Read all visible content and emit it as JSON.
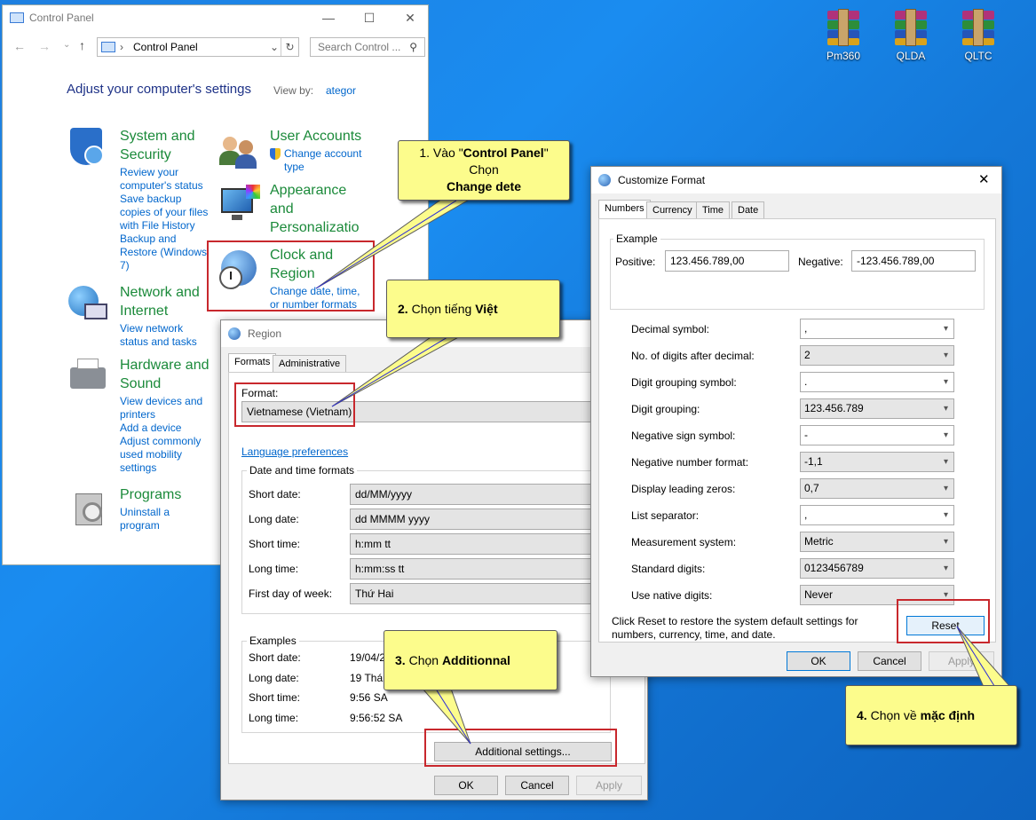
{
  "desktop": {
    "icons": [
      {
        "label": "Pm360"
      },
      {
        "label": "QLDA"
      },
      {
        "label": "QLTC"
      }
    ]
  },
  "control_panel": {
    "title": "Control Panel",
    "address": "Control Panel",
    "search_placeholder": "Search Control ...",
    "heading": "Adjust your computer's settings",
    "view_by_label": "View by:",
    "view_by_value": "ategor",
    "categories": [
      {
        "title": "System and Security",
        "links": [
          "Review your computer's status",
          "Save backup copies of your files with File History",
          "Backup and Restore (Windows 7)"
        ]
      },
      {
        "title": "Network and Internet",
        "links": [
          "View network status and tasks"
        ]
      },
      {
        "title": "Hardware and Sound",
        "links": [
          "View devices and printers",
          "Add a device",
          "Adjust commonly used mobility settings"
        ]
      },
      {
        "title": "Programs",
        "links": [
          "Uninstall a program"
        ]
      },
      {
        "title": "User Accounts",
        "links": [
          "Change account type"
        ]
      },
      {
        "title": "Appearance and Personalizatio",
        "links": []
      },
      {
        "title": "Clock and Region",
        "links": [
          "Change date, time, or number formats"
        ]
      }
    ]
  },
  "region": {
    "title": "Region",
    "tabs": [
      "Formats",
      "Administrative"
    ],
    "format_label": "Format:",
    "format_value": "Vietnamese (Vietnam)",
    "language_link": "Language preferences",
    "dt_group": "Date and time formats",
    "rows": [
      {
        "label": "Short date:",
        "value": "dd/MM/yyyy"
      },
      {
        "label": "Long date:",
        "value": "dd MMMM yyyy"
      },
      {
        "label": "Short time:",
        "value": "h:mm tt"
      },
      {
        "label": "Long time:",
        "value": "h:mm:ss tt"
      },
      {
        "label": "First day of week:",
        "value": "Thứ Hai"
      }
    ],
    "examples_group": "Examples",
    "examples": [
      {
        "label": "Short date:",
        "value": "19/04/2"
      },
      {
        "label": "Long date:",
        "value": "19 Thán"
      },
      {
        "label": "Short time:",
        "value": "9:56 SA"
      },
      {
        "label": "Long time:",
        "value": "9:56:52 SA"
      }
    ],
    "additional": "Additional settings...",
    "ok": "OK",
    "cancel": "Cancel",
    "apply": "Apply"
  },
  "customize": {
    "title": "Customize Format",
    "tabs": [
      "Numbers",
      "Currency",
      "Time",
      "Date"
    ],
    "example_group": "Example",
    "positive_label": "Positive:",
    "positive_value": "123.456.789,00",
    "negative_label": "Negative:",
    "negative_value": "-123.456.789,00",
    "rows": [
      {
        "label": "Decimal symbol:",
        "value": ","
      },
      {
        "label": "No. of digits after decimal:",
        "value": "2"
      },
      {
        "label": "Digit grouping symbol:",
        "value": "."
      },
      {
        "label": "Digit grouping:",
        "value": "123.456.789"
      },
      {
        "label": "Negative sign symbol:",
        "value": "-"
      },
      {
        "label": "Negative number format:",
        "value": "-1,1"
      },
      {
        "label": "Display leading zeros:",
        "value": "0,7"
      },
      {
        "label": "List separator:",
        "value": ","
      },
      {
        "label": "Measurement system:",
        "value": "Metric"
      },
      {
        "label": "Standard digits:",
        "value": "0123456789"
      },
      {
        "label": "Use native digits:",
        "value": "Never"
      }
    ],
    "reset_note_1": "Click Reset to restore the system default settings for",
    "reset_note_2": "numbers, currency, time, and date.",
    "reset": "Reset",
    "ok": "OK",
    "cancel": "Cancel",
    "apply": "Apply"
  },
  "callouts": {
    "c1_l1a": "1. Vào \"",
    "c1_l1b": "Control Panel",
    "c1_l1c": "\"",
    "c1_l2": "Chọn",
    "c1_l3": "Change dete",
    "c2_a": "2. ",
    "c2_b": "Chọn tiếng ",
    "c2_c": "Việt",
    "c3_a": "3. ",
    "c3_b": "Chọn ",
    "c3_c": "Additionnal",
    "c4_a": "4. ",
    "c4_b": "Chọn về ",
    "c4_c": "mặc định"
  }
}
